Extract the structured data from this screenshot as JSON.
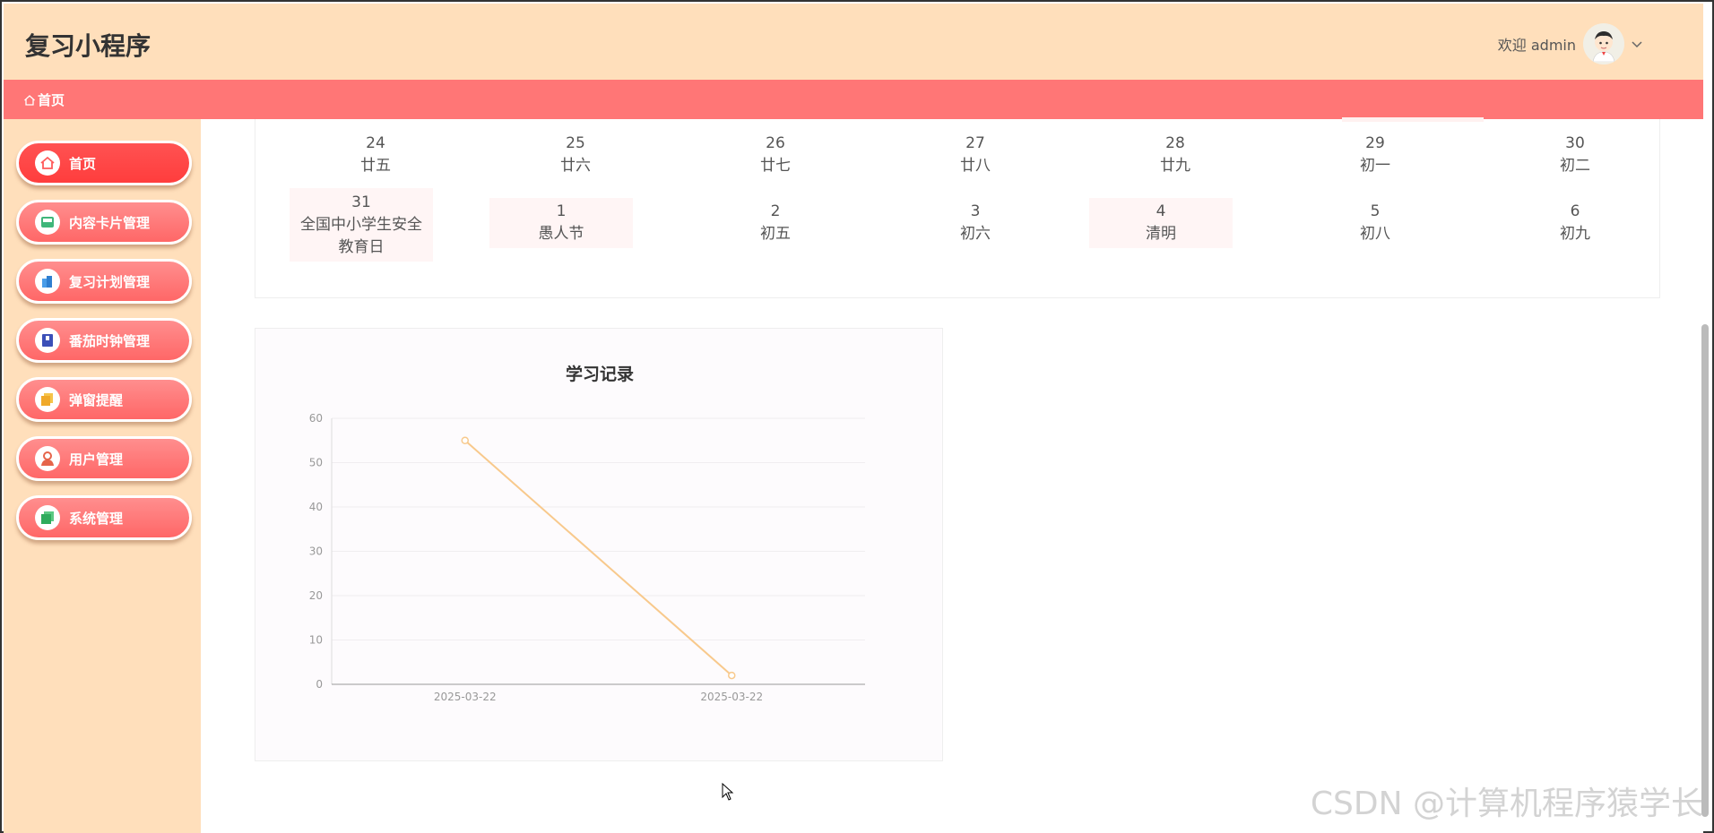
{
  "header": {
    "title": "复习小程序",
    "welcome": "欢迎 admin"
  },
  "breadcrumb": {
    "home": "首页"
  },
  "sidebar": {
    "items": [
      {
        "label": "首页",
        "icon": "home-icon",
        "icon_color": "#ff5a5a"
      },
      {
        "label": "内容卡片管理",
        "icon": "card-icon",
        "icon_color": "#3fb67a"
      },
      {
        "label": "复习计划管理",
        "icon": "building-icon",
        "icon_color": "#4a9de8"
      },
      {
        "label": "番茄时钟管理",
        "icon": "book-icon",
        "icon_color": "#3b4fb8"
      },
      {
        "label": "弹窗提醒",
        "icon": "stack-icon",
        "icon_color": "#f0b429"
      },
      {
        "label": "用户管理",
        "icon": "user-icon",
        "icon_color": "#e6644a"
      },
      {
        "label": "系统管理",
        "icon": "windows-icon",
        "icon_color": "#2eab5c"
      }
    ]
  },
  "calendar": {
    "row1": [
      {
        "day": "24",
        "sub": "廿五"
      },
      {
        "day": "25",
        "sub": "廿六"
      },
      {
        "day": "26",
        "sub": "廿七"
      },
      {
        "day": "27",
        "sub": "廿八"
      },
      {
        "day": "28",
        "sub": "廿九"
      },
      {
        "day": "29",
        "sub": "初一"
      },
      {
        "day": "30",
        "sub": "初二"
      }
    ],
    "row2": [
      {
        "day": "31",
        "sub": "全国中小学生安全教育日"
      },
      {
        "day": "1",
        "sub": "愚人节"
      },
      {
        "day": "2",
        "sub": "初五"
      },
      {
        "day": "3",
        "sub": "初六"
      },
      {
        "day": "4",
        "sub": "清明"
      },
      {
        "day": "5",
        "sub": "初八"
      },
      {
        "day": "6",
        "sub": "初九"
      }
    ]
  },
  "chart_data": {
    "type": "line",
    "title": "学习记录",
    "categories": [
      "2025-03-22",
      "2025-03-22"
    ],
    "series": [
      {
        "values": [
          55,
          2
        ]
      }
    ],
    "ylim": [
      0,
      60
    ],
    "yticks": [
      "0",
      "10",
      "20",
      "30",
      "40",
      "50",
      "60"
    ],
    "grid": true,
    "color": "#f8c98c"
  },
  "watermark": "CSDN @计算机程序猿学长"
}
